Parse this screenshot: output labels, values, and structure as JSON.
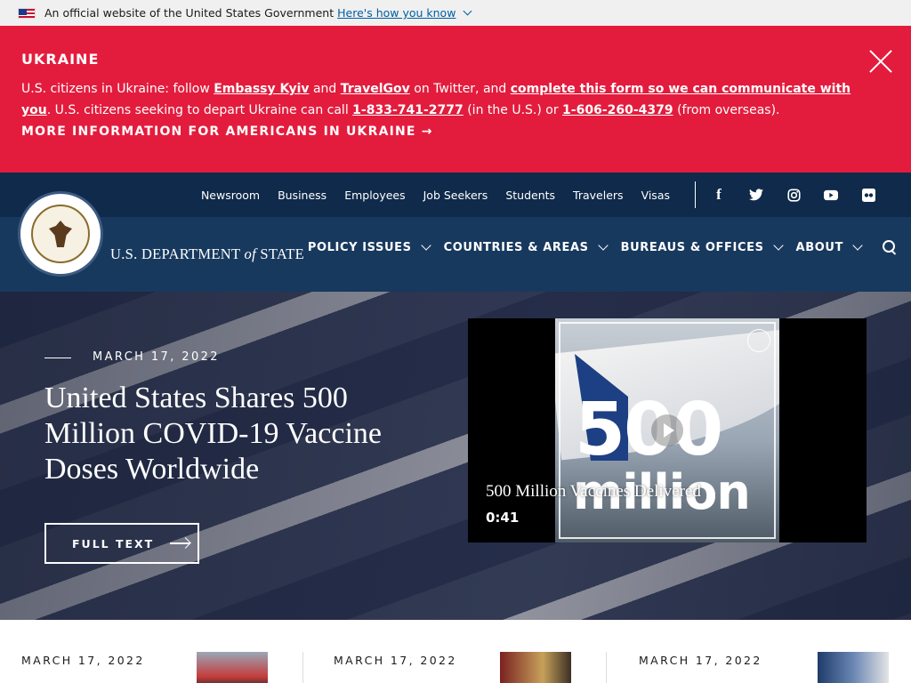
{
  "gov_banner": {
    "text": "An official website of the United States Government",
    "link": "Here's how you know"
  },
  "alert": {
    "title": "UKRAINE",
    "p1": "U.S. citizens in Ukraine: follow ",
    "link1": "Embassy Kyiv",
    "p2": " and ",
    "link2": "TravelGov",
    "p3": " on Twitter, and ",
    "link3": "complete this form so we can communicate with you",
    "p4": ". U.S. citizens seeking to depart Ukraine can call ",
    "link4": "1-833-741-2777",
    "p5": " (in the U.S.) or ",
    "link5": "1-606-260-4379",
    "p6": " (from overseas).",
    "more": "MORE INFORMATION FOR AMERICANS IN UKRAINE →"
  },
  "utility_nav": [
    "Newsroom",
    "Business",
    "Employees",
    "Job Seekers",
    "Students",
    "Travelers",
    "Visas"
  ],
  "social": {
    "facebook": "f",
    "flickr": "●●"
  },
  "header": {
    "dept_prefix": "U.S. DEPARTMENT ",
    "dept_of": "of",
    "dept_suffix": " STATE"
  },
  "main_nav": [
    "POLICY ISSUES",
    "COUNTRIES & AREAS",
    "BUREAUS & OFFICES",
    "ABOUT"
  ],
  "hero": {
    "date": "MARCH 17, 2022",
    "title": "United States Shares 500 Million COVID-19 Vaccine Doses Worldwide",
    "button": "FULL TEXT"
  },
  "video": {
    "big_number": "500",
    "big_word": "million",
    "title": "500 Million Vaccines Delivered",
    "duration": "0:41"
  },
  "cards": [
    {
      "date": "MARCH 17, 2022"
    },
    {
      "date": "MARCH 17, 2022"
    },
    {
      "date": "MARCH 17, 2022"
    }
  ],
  "colors": {
    "alert_red": "#e31c3d",
    "header_navy": "#18395e",
    "utility_navy": "#0f2a4a",
    "gov_link": "#005ea2"
  }
}
